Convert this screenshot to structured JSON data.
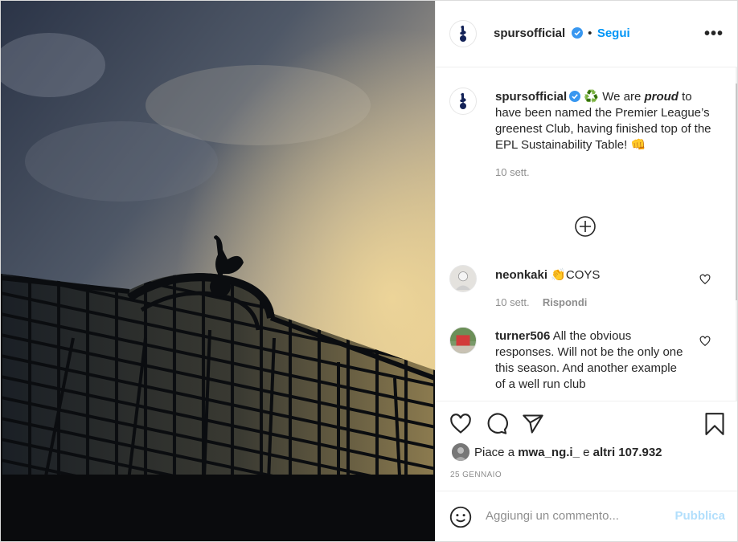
{
  "post": {
    "username": "spursofficial",
    "follow_label": "Segui",
    "more_icon": "more-options-icon",
    "caption": {
      "emoji_recycle": "♻️",
      "text_before": "We are",
      "emphasis": "proud",
      "text_after": "to have been named the Premier League’s greenest Club, having finished top of the EPL Sustainability Table!",
      "emoji_fist": "👊",
      "time": "10 sett."
    },
    "load_more_icon": "plus-circle-icon",
    "comments": [
      {
        "username": "neonkaki",
        "text": "👏COYS",
        "time": "10 sett.",
        "reply_label": "Rispondi"
      },
      {
        "username": "turner506",
        "text": "All the obvious responses. Will not be the only one this season. And another example of a well run club"
      }
    ],
    "likes": {
      "prefix": "Piace a",
      "user": "mwa_ng.i_",
      "middle": "e",
      "others": "altri 107.932"
    },
    "date": "25 GENNAIO",
    "comment_placeholder": "Aggiungi un commento...",
    "publish_label": "Pubblica"
  },
  "colors": {
    "accent_blue": "#0095f6",
    "publish_disabled": "#b2dffc",
    "verified_blue": "#3897f0",
    "text": "#262626",
    "muted": "#8e8e8e"
  }
}
